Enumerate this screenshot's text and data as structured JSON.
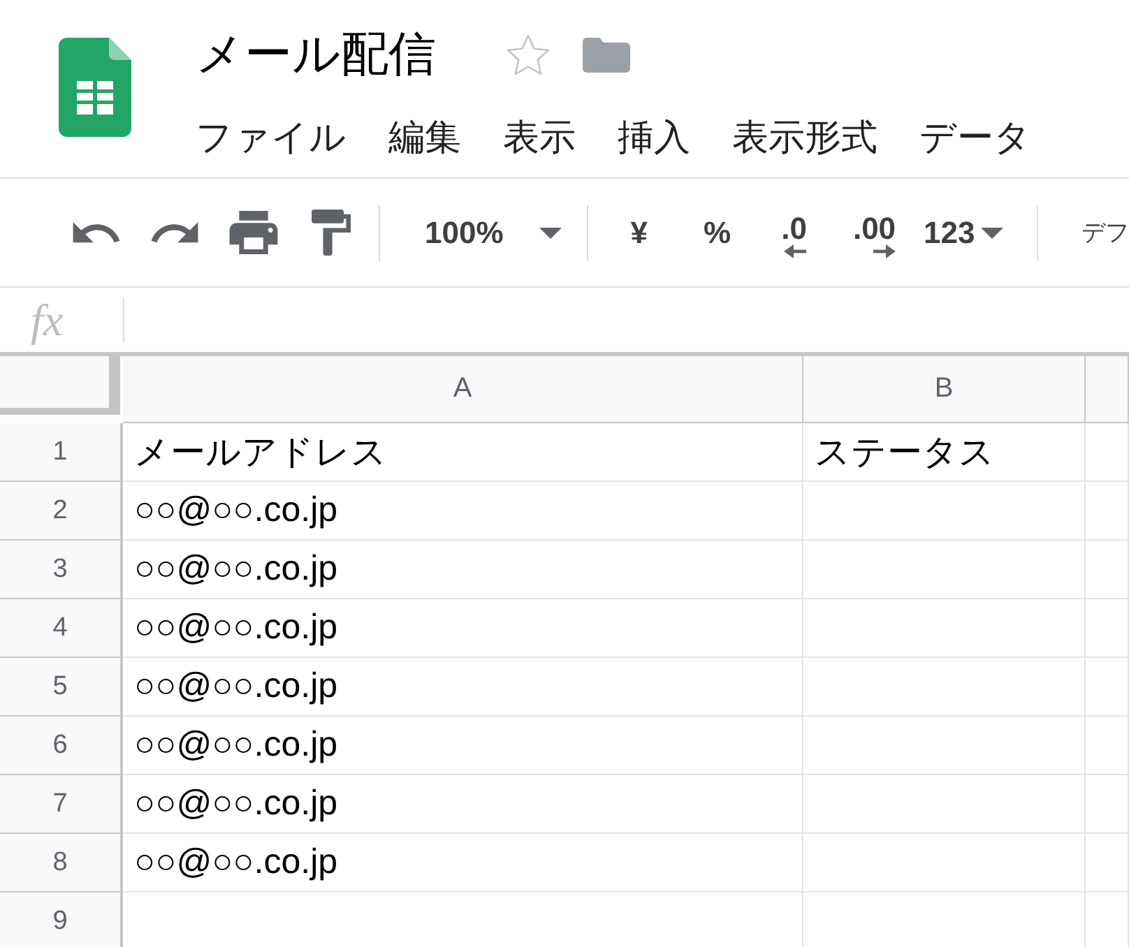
{
  "document": {
    "title": "メール配信",
    "starred": false
  },
  "menu": [
    "ファイル",
    "編集",
    "表示",
    "挿入",
    "表示形式",
    "データ"
  ],
  "toolbar": {
    "zoom": "100%",
    "currency": "¥",
    "percent": "%",
    "decrease_decimal": ".0",
    "increase_decimal": ".00",
    "number_format": "123",
    "font": "デフ"
  },
  "formula_bar": {
    "label": "fx"
  },
  "sheet": {
    "columns": [
      "A",
      "B"
    ],
    "rows": [
      {
        "number": "1",
        "cells": [
          "メールアドレス",
          "ステータス"
        ]
      },
      {
        "number": "2",
        "cells": [
          "○○@○○.co.jp"
        ]
      },
      {
        "number": "3",
        "cells": [
          "○○@○○.co.jp"
        ]
      },
      {
        "number": "4",
        "cells": [
          "○○@○○.co.jp"
        ]
      },
      {
        "number": "5",
        "cells": [
          "○○@○○.co.jp"
        ]
      },
      {
        "number": "6",
        "cells": [
          "○○@○○.co.jp"
        ]
      },
      {
        "number": "7",
        "cells": [
          "○○@○○.co.jp"
        ]
      },
      {
        "number": "8",
        "cells": [
          "○○@○○.co.jp"
        ]
      },
      {
        "number": "9"
      }
    ]
  }
}
